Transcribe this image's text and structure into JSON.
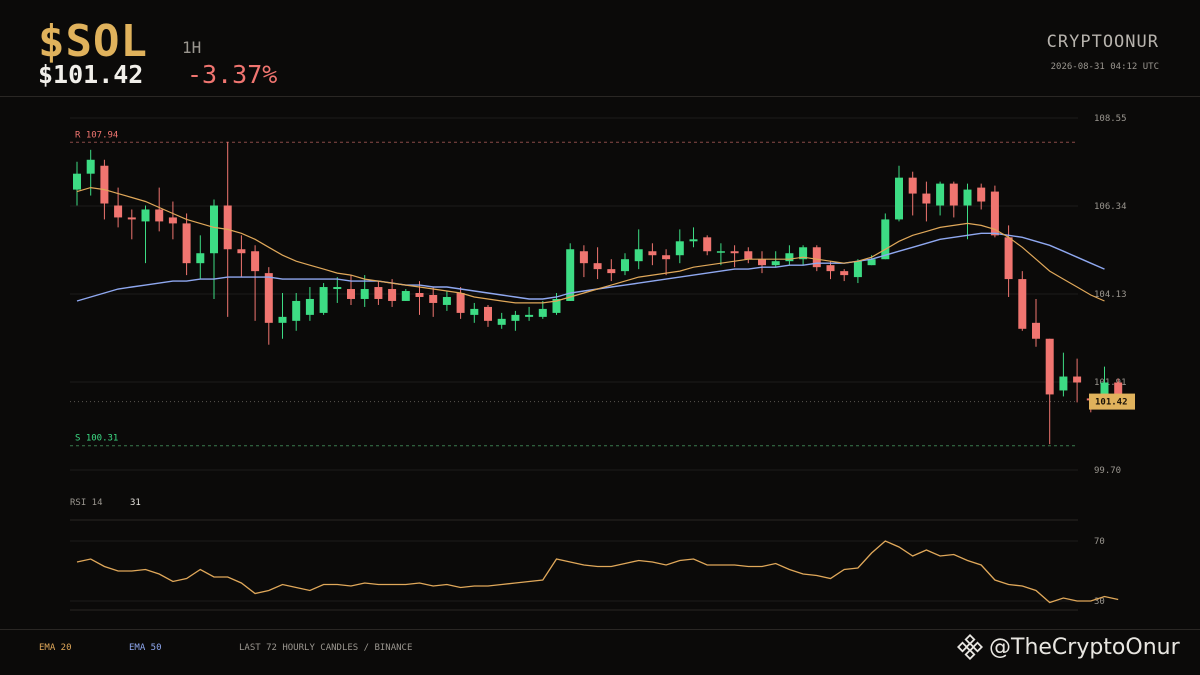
{
  "header": {
    "ticker": "$SOL",
    "timeframe": "1H",
    "price": "$101.42",
    "change": "-3.37%",
    "brand": "CRYPTOONUR",
    "timestamp": "2026-08-31 04:12 UTC"
  },
  "footer": {
    "ema20_label": "EMA 20",
    "ema50_label": "EMA 50",
    "source": "LAST 72 HOURLY CANDLES / BINANCE",
    "watermark": "@TheCryptoOnur"
  },
  "colors": {
    "up": "#3ddc84",
    "down": "#f07570",
    "ema20": "#e0a85a",
    "ema50": "#8fa8f0",
    "current_price_bg": "#e0b25c",
    "ticker": "#e0b25c"
  },
  "chart_data": [
    {
      "type": "candlestick",
      "ylim": [
        99.7,
        108.55
      ],
      "y_ticks": [
        "108.55",
        "106.34",
        "104.13",
        "101.91",
        "99.70"
      ],
      "resistance": {
        "label": "R 107.94",
        "value": 107.94
      },
      "support": {
        "label": "S 100.31",
        "value": 100.31
      },
      "current_price": {
        "label": "101.42",
        "value": 101.42
      },
      "candles": [
        [
          106.75,
          107.15,
          106.35,
          107.45
        ],
        [
          107.15,
          107.5,
          106.6,
          107.75
        ],
        [
          107.35,
          106.4,
          106.0,
          107.5
        ],
        [
          106.35,
          106.05,
          105.8,
          106.8
        ],
        [
          106.05,
          106.0,
          105.5,
          106.25
        ],
        [
          105.95,
          106.25,
          104.9,
          106.35
        ],
        [
          106.25,
          105.95,
          105.7,
          106.8
        ],
        [
          106.05,
          105.9,
          105.5,
          106.45
        ],
        [
          105.9,
          104.9,
          104.6,
          106.15
        ],
        [
          104.9,
          105.15,
          104.5,
          105.6
        ],
        [
          105.15,
          106.35,
          104.0,
          106.5
        ],
        [
          106.35,
          105.25,
          103.55,
          107.95
        ],
        [
          105.25,
          105.15,
          104.55,
          105.6
        ],
        [
          105.2,
          104.7,
          103.45,
          105.35
        ],
        [
          104.65,
          103.4,
          102.85,
          104.8
        ],
        [
          103.4,
          103.55,
          103.0,
          104.15
        ],
        [
          103.45,
          103.95,
          103.2,
          104.15
        ],
        [
          103.6,
          104.0,
          103.45,
          104.3
        ],
        [
          103.65,
          104.3,
          103.6,
          104.4
        ],
        [
          104.25,
          104.3,
          103.9,
          104.55
        ],
        [
          104.25,
          104.0,
          103.85,
          104.6
        ],
        [
          104.0,
          104.25,
          103.8,
          104.6
        ],
        [
          104.3,
          104.0,
          103.85,
          104.45
        ],
        [
          104.25,
          103.95,
          103.8,
          104.5
        ],
        [
          103.95,
          104.2,
          103.95,
          104.25
        ],
        [
          104.15,
          104.05,
          103.6,
          104.45
        ],
        [
          104.1,
          103.9,
          103.55,
          104.3
        ],
        [
          103.85,
          104.05,
          103.7,
          104.2
        ],
        [
          104.15,
          103.65,
          103.5,
          104.3
        ],
        [
          103.6,
          103.75,
          103.4,
          103.9
        ],
        [
          103.8,
          103.45,
          103.3,
          103.85
        ],
        [
          103.35,
          103.5,
          103.25,
          103.65
        ],
        [
          103.45,
          103.6,
          103.2,
          103.7
        ],
        [
          103.55,
          103.6,
          103.45,
          103.8
        ],
        [
          103.55,
          103.75,
          103.5,
          103.95
        ],
        [
          103.65,
          104.0,
          103.6,
          104.15
        ],
        [
          103.95,
          105.25,
          103.95,
          105.4
        ],
        [
          105.2,
          104.9,
          104.55,
          105.35
        ],
        [
          104.9,
          104.75,
          104.5,
          105.3
        ],
        [
          104.75,
          104.65,
          104.45,
          105.0
        ],
        [
          104.7,
          105.0,
          104.6,
          105.15
        ],
        [
          104.95,
          105.25,
          104.75,
          105.75
        ],
        [
          105.2,
          105.1,
          104.85,
          105.4
        ],
        [
          105.1,
          105.0,
          104.6,
          105.25
        ],
        [
          105.1,
          105.45,
          104.9,
          105.75
        ],
        [
          105.45,
          105.5,
          105.3,
          105.8
        ],
        [
          105.55,
          105.2,
          105.1,
          105.6
        ],
        [
          105.2,
          105.2,
          104.85,
          105.4
        ],
        [
          105.2,
          105.15,
          104.8,
          105.35
        ],
        [
          105.2,
          105.0,
          104.9,
          105.3
        ],
        [
          105.0,
          104.85,
          104.65,
          105.2
        ],
        [
          104.85,
          104.95,
          104.8,
          105.2
        ],
        [
          104.95,
          105.15,
          104.85,
          105.35
        ],
        [
          105.0,
          105.3,
          104.85,
          105.35
        ],
        [
          105.3,
          104.8,
          104.7,
          105.35
        ],
        [
          104.85,
          104.7,
          104.5,
          104.95
        ],
        [
          104.7,
          104.6,
          104.45,
          104.75
        ],
        [
          104.55,
          104.95,
          104.4,
          105.0
        ],
        [
          104.85,
          105.0,
          104.85,
          105.1
        ],
        [
          105.0,
          106.0,
          105.0,
          106.15
        ],
        [
          106.0,
          107.05,
          105.95,
          107.35
        ],
        [
          107.05,
          106.65,
          106.1,
          107.2
        ],
        [
          106.65,
          106.4,
          105.95,
          106.95
        ],
        [
          106.35,
          106.9,
          106.1,
          106.95
        ],
        [
          106.9,
          106.35,
          106.05,
          106.95
        ],
        [
          106.35,
          106.75,
          105.5,
          106.9
        ],
        [
          106.8,
          106.45,
          106.25,
          106.9
        ],
        [
          106.7,
          105.6,
          105.55,
          106.85
        ],
        [
          105.55,
          104.5,
          104.05,
          105.85
        ],
        [
          104.5,
          103.25,
          103.2,
          104.7
        ],
        [
          103.4,
          103.0,
          102.8,
          104.0
        ],
        [
          103.0,
          101.6,
          100.35,
          103.0
        ],
        [
          101.7,
          102.05,
          101.55,
          102.65
        ],
        [
          102.05,
          101.9,
          101.4,
          102.5
        ],
        [
          101.5,
          101.45,
          101.15,
          101.5
        ],
        [
          101.5,
          101.9,
          101.35,
          102.3
        ],
        [
          101.9,
          101.42,
          101.3,
          102.0
        ]
      ],
      "ema20": [
        106.7,
        106.8,
        106.75,
        106.65,
        106.55,
        106.45,
        106.3,
        106.15,
        106.0,
        105.9,
        105.8,
        105.75,
        105.65,
        105.5,
        105.3,
        105.1,
        104.95,
        104.85,
        104.75,
        104.65,
        104.6,
        104.5,
        104.45,
        104.4,
        104.35,
        104.3,
        104.25,
        104.2,
        104.15,
        104.05,
        104.0,
        103.95,
        103.9,
        103.9,
        103.9,
        103.95,
        104.05,
        104.15,
        104.25,
        104.35,
        104.45,
        104.55,
        104.6,
        104.65,
        104.7,
        104.8,
        104.85,
        104.9,
        104.95,
        105.0,
        105.0,
        105.0,
        105.0,
        105.05,
        105.0,
        104.95,
        104.9,
        104.95,
        105.05,
        105.25,
        105.45,
        105.6,
        105.7,
        105.8,
        105.85,
        105.9,
        105.85,
        105.75,
        105.55,
        105.3,
        105.0,
        104.7,
        104.5,
        104.3,
        104.1,
        103.95
      ],
      "ema50": [
        103.95,
        104.05,
        104.15,
        104.25,
        104.3,
        104.35,
        104.4,
        104.45,
        104.45,
        104.5,
        104.5,
        104.55,
        104.55,
        104.55,
        104.55,
        104.5,
        104.5,
        104.5,
        104.5,
        104.5,
        104.45,
        104.45,
        104.45,
        104.4,
        104.35,
        104.35,
        104.3,
        104.3,
        104.25,
        104.2,
        104.15,
        104.1,
        104.05,
        104.0,
        104.0,
        104.05,
        104.15,
        104.2,
        104.25,
        104.3,
        104.35,
        104.4,
        104.45,
        104.5,
        104.55,
        104.6,
        104.65,
        104.7,
        104.75,
        104.75,
        104.8,
        104.8,
        104.85,
        104.85,
        104.9,
        104.9,
        104.9,
        104.95,
        105.0,
        105.1,
        105.2,
        105.3,
        105.4,
        105.5,
        105.55,
        105.6,
        105.65,
        105.65,
        105.6,
        105.55,
        105.45,
        105.35,
        105.2,
        105.05,
        104.9,
        104.75
      ]
    },
    {
      "type": "line",
      "label": "RSI 14",
      "value_label": "31",
      "ylim": [
        24,
        84
      ],
      "y_ticks": [
        "70",
        "30"
      ],
      "values": [
        56,
        58,
        53,
        50,
        50,
        51,
        48,
        43,
        45,
        51,
        46,
        46,
        42,
        35,
        37,
        41,
        39,
        37,
        41,
        41,
        40,
        42,
        41,
        41,
        41,
        42,
        40,
        41,
        39,
        40,
        40,
        41,
        42,
        43,
        44,
        58,
        56,
        54,
        53,
        53,
        55,
        57,
        56,
        54,
        57,
        58,
        54,
        54,
        54,
        53,
        53,
        55,
        51,
        48,
        47,
        45,
        51,
        52,
        62,
        70,
        66,
        60,
        64,
        60,
        61,
        57,
        54,
        44,
        41,
        40,
        37,
        29,
        32,
        30,
        30,
        33,
        31
      ]
    }
  ]
}
